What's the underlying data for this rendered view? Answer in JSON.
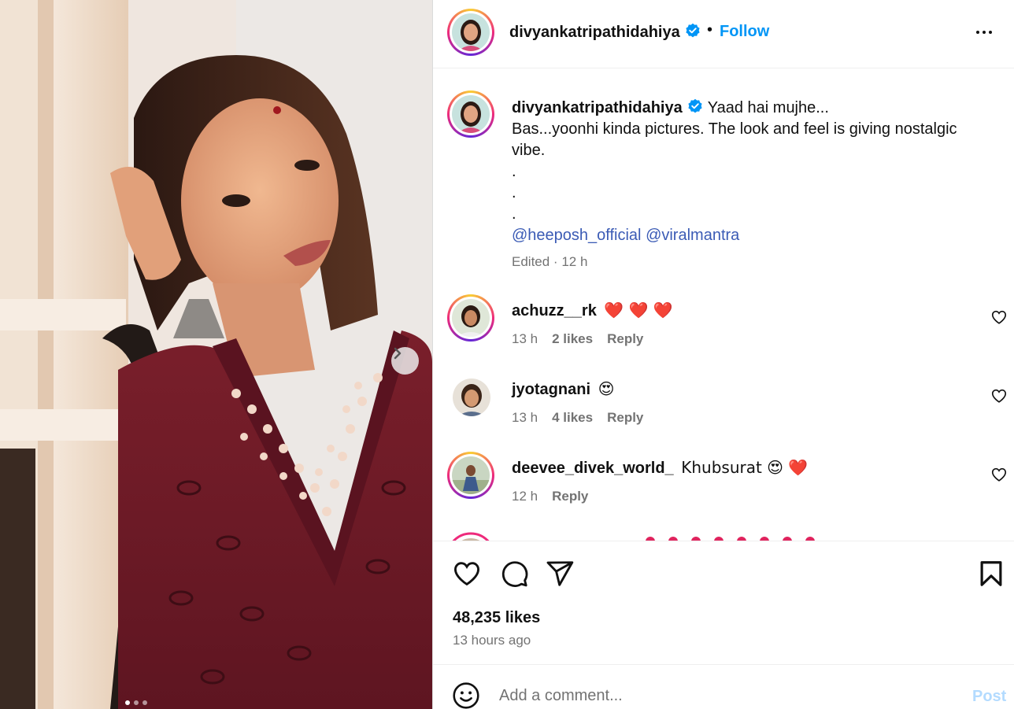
{
  "post": {
    "username": "divyankatripathidahiya",
    "follow_label": "Follow",
    "separator": "•"
  },
  "caption": {
    "username": "divyankatripathidahiya",
    "line1": "Yaad hai mujhe...",
    "line2": "Bas...yoonhi kinda pictures. The look and feel is giving nostalgic vibe.",
    "dot1": ".",
    "dot2": ".",
    "dot3": ".",
    "mention1": "@heeposh_official",
    "mention2": "@viralmantra",
    "edited": "Edited",
    "time": "12 h"
  },
  "comments": [
    {
      "username": "achuzz__rk",
      "text": "❤️ ❤️ ❤️",
      "time": "13 h",
      "likes": "2 likes",
      "reply": "Reply"
    },
    {
      "username": "jyotagnani",
      "text": "😍",
      "time": "13 h",
      "likes": "4 likes",
      "reply": "Reply"
    },
    {
      "username": "deevee_divek_world_",
      "text": "Khubsurat 😍 ❤️",
      "time": "12 h",
      "reply": "Reply"
    }
  ],
  "stats": {
    "likes": "48,235 likes",
    "posted": "13 hours ago"
  },
  "composer": {
    "placeholder": "Add a comment...",
    "post_label": "Post"
  },
  "carousel": {
    "current": 1,
    "total": 3
  },
  "colors": {
    "accent": "#0095f6",
    "mention": "#3b5bb5",
    "muted": "#737373",
    "like_red": "#ff3040",
    "post_disabled": "#b3dbff"
  },
  "icons": {
    "verified": "verified-badge-icon",
    "more": "more-options-icon",
    "like": "heart-icon",
    "comment": "comment-icon",
    "share": "share-icon",
    "save": "bookmark-icon",
    "emoji": "emoji-icon",
    "next": "chevron-right-icon"
  }
}
